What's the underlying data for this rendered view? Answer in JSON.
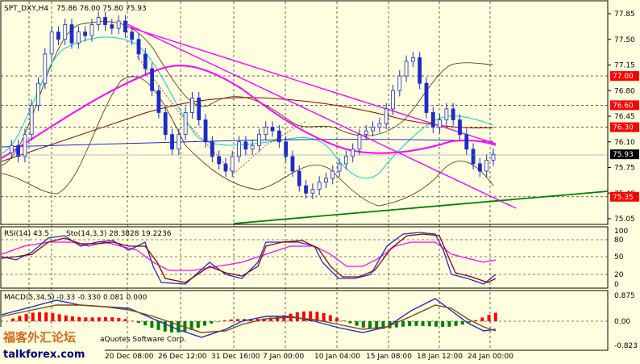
{
  "header": {
    "symbol_tf": "SPT_DXY,H4",
    "ohlc": "75.86 76.00 75.80 75.93"
  },
  "rsi": {
    "caption": "RSI(14) 43.5",
    "stoch": "Sto(14,3,3) 28.3828 19.2236",
    "levels": [
      "100",
      "80",
      "50",
      "20",
      "0"
    ]
  },
  "macd": {
    "caption": "MACD(5,34,5)",
    "values": "-0.33 -0.330 0.081 0.000",
    "levels": [
      "0.875",
      "0.00",
      "-0.823"
    ]
  },
  "price_axis": {
    "ticks": [
      "77.85",
      "77.50",
      "77.15",
      "76.80",
      "76.45",
      "76.10",
      "75.75",
      "75.40",
      "75.05"
    ]
  },
  "price_marks": [
    {
      "value": "77.00",
      "color": "#FF0000"
    },
    {
      "value": "76.60",
      "color": "#FF0000"
    },
    {
      "value": "76.30",
      "color": "#FF0000"
    },
    {
      "value": "75.93",
      "color": "#000000"
    },
    {
      "value": "75.35",
      "color": "#FF0000"
    }
  ],
  "time_axis": [
    "20 Dec 08:00",
    "26 Dec 12:00",
    "31 Dec 16:00",
    "7 Jan 00:00",
    "10 Jan 04:00",
    "15 Jan 08:00",
    "18 Jan 12:00",
    "24 Jan 00:00"
  ],
  "watermark": {
    "cn": "福客外汇论坛",
    "site": "talkforex.com",
    "software": "aQuotes Software Corp."
  },
  "colors": {
    "bg": "#FFFFE0",
    "candle": "#1C2BC8",
    "ma_fast": "#00CED1",
    "ma_mid": "#8B0000",
    "ma_slow": "#FF00FF",
    "bands": "#4B2A00",
    "trend": "#008000",
    "trend2": "#FF00FF",
    "macd_up": "#FF0000",
    "macd_down": "#008000"
  }
}
